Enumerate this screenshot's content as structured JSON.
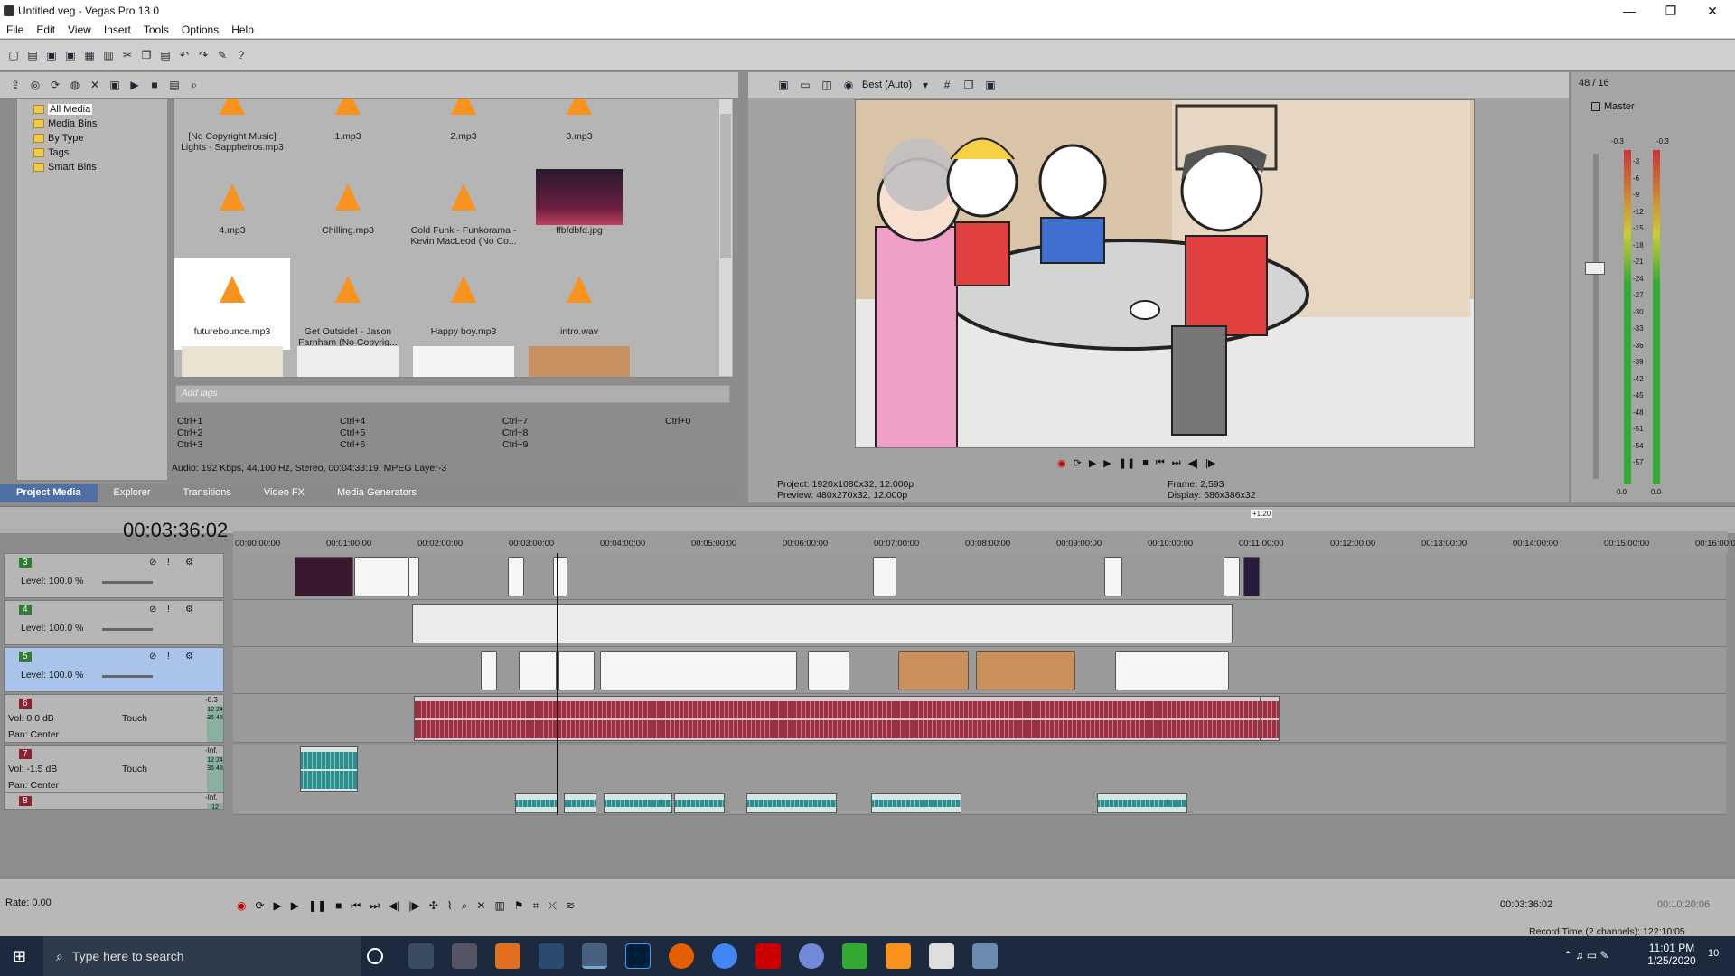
{
  "window": {
    "title": "Untitled.veg - Vegas Pro 13.0",
    "minimize": "—",
    "maximize": "❐",
    "close": "✕"
  },
  "menu": [
    "File",
    "Edit",
    "View",
    "Insert",
    "Tools",
    "Options",
    "Help"
  ],
  "project_media": {
    "tree": [
      "All Media",
      "Media Bins",
      "By Type",
      "Tags",
      "Smart Bins"
    ],
    "files": [
      {
        "name": "[No Copyright Music] Lights - Sappheiros.mp3",
        "kind": "audio"
      },
      {
        "name": "1.mp3",
        "kind": "audio"
      },
      {
        "name": "2.mp3",
        "kind": "audio"
      },
      {
        "name": "3.mp3",
        "kind": "audio"
      },
      {
        "name": "4.mp3",
        "kind": "audio"
      },
      {
        "name": "Chilling.mp3",
        "kind": "audio"
      },
      {
        "name": "Cold Funk - Funkorama - Kevin MacLeod (No Co...",
        "kind": "audio"
      },
      {
        "name": "ffbfdbfd.jpg",
        "kind": "image"
      },
      {
        "name": "futurebounce.mp3",
        "kind": "audio",
        "selected": true
      },
      {
        "name": "Get Outside! - Jason Farnham (No Copyrig...",
        "kind": "audio"
      },
      {
        "name": "Happy boy.mp3",
        "kind": "audio"
      },
      {
        "name": "intro.wav",
        "kind": "audio"
      }
    ],
    "tags_placeholder": "Add tags",
    "shortcuts": [
      "Ctrl+1",
      "Ctrl+2",
      "Ctrl+3",
      "Ctrl+4",
      "Ctrl+5",
      "Ctrl+6",
      "Ctrl+7",
      "Ctrl+8",
      "Ctrl+9",
      "Ctrl+0"
    ],
    "status": "Audio: 192 Kbps, 44,100 Hz, Stereo, 00:04:33:19, MPEG Layer-3",
    "tabs": [
      "Project Media",
      "Explorer",
      "Transitions",
      "Video FX",
      "Media Generators"
    ]
  },
  "preview": {
    "quality": "Best (Auto)",
    "project_label": "Project:",
    "project_value": "1920x1080x32, 12.000p",
    "preview_label": "Preview:",
    "preview_value": "480x270x32, 12.000p",
    "frame_label": "Frame:",
    "frame_value": "2,593",
    "display_label": "Display:",
    "display_value": "686x386x32"
  },
  "master": {
    "counter": "48 / 16",
    "label": "Master",
    "top_left": "-0.3",
    "top_right": "-0.3",
    "scale": [
      "3",
      "6",
      "9",
      "12",
      "15",
      "18",
      "21",
      "24",
      "27",
      "30",
      "33",
      "36",
      "39",
      "42",
      "45",
      "48",
      "51",
      "54",
      "57"
    ],
    "bottom_left": "0.0",
    "bottom_right": "0.0"
  },
  "timeline": {
    "timecode": "00:03:36:02",
    "marker_label": "+1:20",
    "ruler": [
      "00:00:00:00",
      "00:01:00:00",
      "00:02:00:00",
      "00:03:00:00",
      "00:04:00:00",
      "00:05:00:00",
      "00:06:00:00",
      "00:07:00:00",
      "00:08:00:00",
      "00:09:00:00",
      "00:10:00:00",
      "00:11:00:00",
      "00:12:00:00",
      "00:13:00:00",
      "00:14:00:00",
      "00:15:00:00",
      "00:16:00:00"
    ],
    "video_tracks": [
      {
        "num": "3",
        "level_label": "Level:",
        "level": "100.0 %"
      },
      {
        "num": "4",
        "level_label": "Level:",
        "level": "100.0 %"
      },
      {
        "num": "5",
        "level_label": "Level:",
        "level": "100.0 %",
        "selected": true
      }
    ],
    "audio_tracks": [
      {
        "num": "6",
        "vol_label": "Vol:",
        "vol": "0.0 dB",
        "pan_label": "Pan:",
        "pan": "Center",
        "mode": "Touch",
        "peak": "-0.3",
        "meter": [
          "12",
          "24",
          "36",
          "48"
        ]
      },
      {
        "num": "7",
        "vol_label": "Vol:",
        "vol": "-1.5 dB",
        "pan_label": "Pan:",
        "pan": "Center",
        "mode": "Touch",
        "peak": "-Inf.",
        "meter": [
          "12",
          "24",
          "36",
          "48"
        ]
      },
      {
        "num": "8",
        "peak": "-Inf.",
        "meter": [
          "12"
        ]
      }
    ]
  },
  "bottom": {
    "rate": "Rate: 0.00",
    "cursor_time": "00:03:36:02",
    "end_time": "00:10:20:06",
    "record_time": "Record Time (2 channels): 122:10:05"
  },
  "taskbar": {
    "search_placeholder": "Type here to search",
    "time": "11:01 PM",
    "date": "1/25/2020",
    "notifications": "10"
  }
}
